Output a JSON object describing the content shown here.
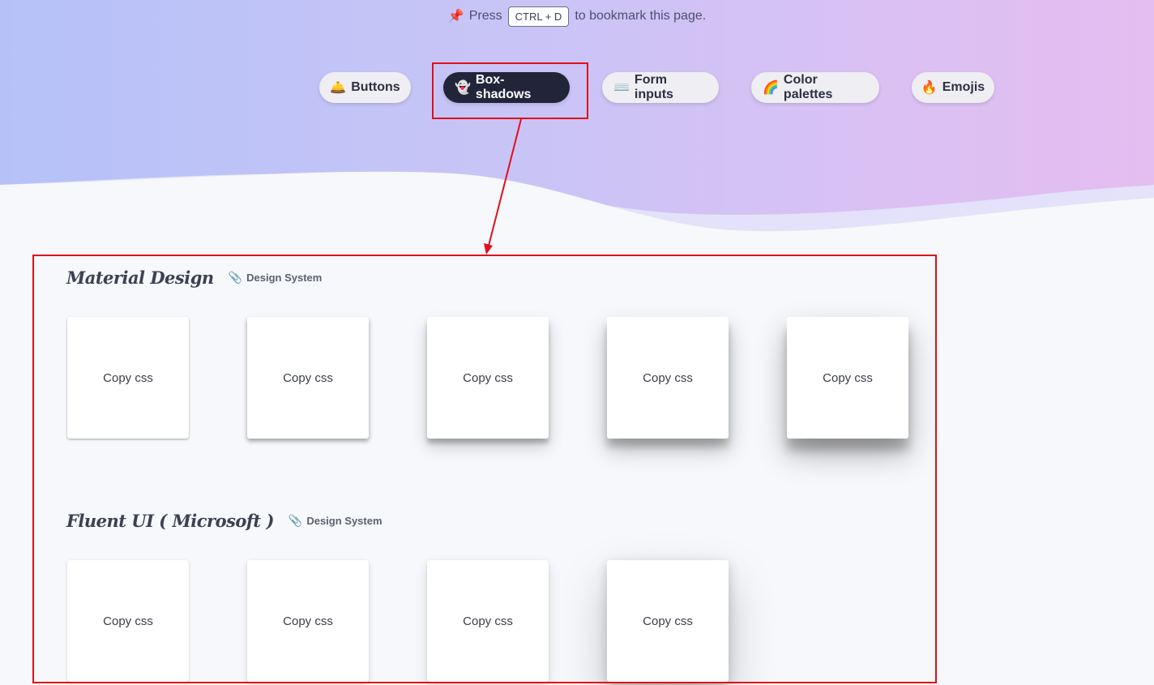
{
  "bookmark": {
    "press": "Press",
    "shortcut": "CTRL + D",
    "suffix": "to bookmark this page.",
    "pin_emoji": "📌"
  },
  "nav": {
    "items": [
      {
        "emoji": "🛎️",
        "label": "Buttons",
        "icon": "bellhop-bell-icon"
      },
      {
        "emoji": "👻",
        "label": "Box-shadows",
        "icon": "ghost-icon",
        "active": true
      },
      {
        "emoji": "⌨️",
        "label": "Form inputs",
        "icon": "keyboard-icon"
      },
      {
        "emoji": "🌈",
        "label": "Color palettes",
        "icon": "rainbow-icon"
      },
      {
        "emoji": "🔥",
        "label": "Emojis",
        "icon": "fire-icon"
      }
    ]
  },
  "sections": [
    {
      "title": "Material Design",
      "tag_emoji": "📎",
      "tag": "Design System",
      "cards": [
        "Copy css",
        "Copy css",
        "Copy css",
        "Copy css",
        "Copy css"
      ]
    },
    {
      "title": "Fluent UI ( Microsoft )",
      "tag_emoji": "📎",
      "tag": "Design System",
      "cards": [
        "Copy css",
        "Copy css",
        "Copy css",
        "Copy css"
      ]
    }
  ],
  "colors": {
    "annotation_red": "#e0101a",
    "active_pill": "#22253a",
    "hero_gradient_start": "#b5c2f8",
    "hero_gradient_end": "#e4bdf1"
  }
}
